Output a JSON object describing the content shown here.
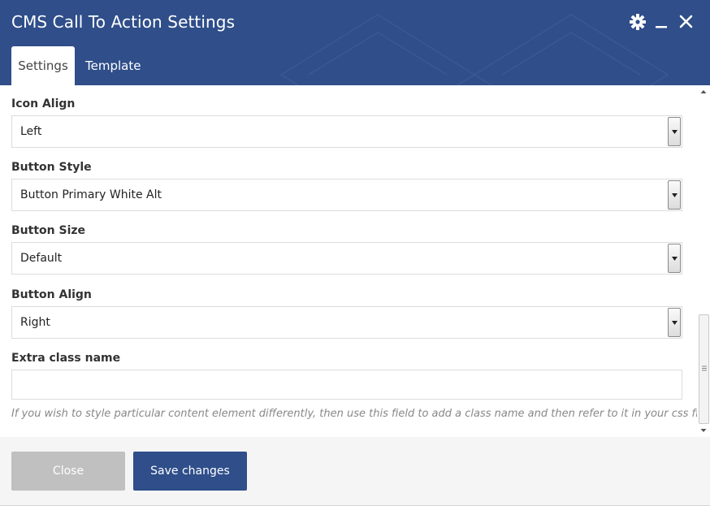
{
  "window": {
    "title": "CMS Call To Action Settings"
  },
  "controls": {
    "gear_icon": "gear-icon",
    "minimize_icon": "minimize-icon",
    "close_icon": "close-icon"
  },
  "tabs": [
    {
      "label": "Settings",
      "active": true
    },
    {
      "label": "Template",
      "active": false
    }
  ],
  "fields": {
    "icon_align": {
      "label": "Icon Align",
      "value": "Left"
    },
    "button_style": {
      "label": "Button Style",
      "value": "Button Primary White Alt"
    },
    "button_size": {
      "label": "Button Size",
      "value": "Default"
    },
    "button_align": {
      "label": "Button Align",
      "value": "Right"
    },
    "extra_class": {
      "label": "Extra class name",
      "value": "",
      "help": "If you wish to style particular content element differently, then use this field to add a class name and then refer to it in your css file."
    }
  },
  "footer": {
    "close_label": "Close",
    "save_label": "Save changes"
  },
  "colors": {
    "header": "#2f4e8a",
    "save_button": "#2f4e8a",
    "close_button": "#c0c0c0"
  }
}
